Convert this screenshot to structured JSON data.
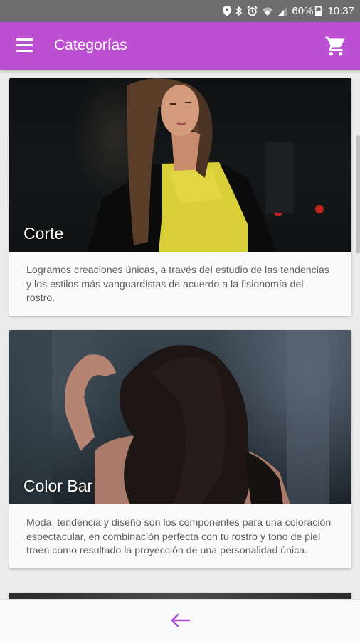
{
  "status_bar": {
    "battery": "60%",
    "time": "10:37",
    "icons": [
      "location-icon",
      "bluetooth-icon",
      "alarm-icon",
      "wifi-icon",
      "signal-icon",
      "battery-icon"
    ]
  },
  "app_bar": {
    "title": "Categorías",
    "menu_icon": "menu-icon",
    "cart_icon": "cart-icon"
  },
  "cards": [
    {
      "title": "Corte",
      "description": "Logramos creaciones únicas, a través del estudio de las tendencias y los estilos más vanguardistas de acuerdo a la fisionomía del rostro."
    },
    {
      "title": "Color Bar",
      "description": "Moda, tendencia y diseño son los componentes para una coloración espectacular, en combinación perfecta con tu rostro y tono de piel traen como resultado la proyección de una personalidad única."
    }
  ],
  "bottom_bar": {
    "back_icon": "back-arrow-icon"
  },
  "colors": {
    "primary": "#bd4fd2",
    "status_bar": "#6d6d6d",
    "back_arrow": "#a84cd0"
  }
}
